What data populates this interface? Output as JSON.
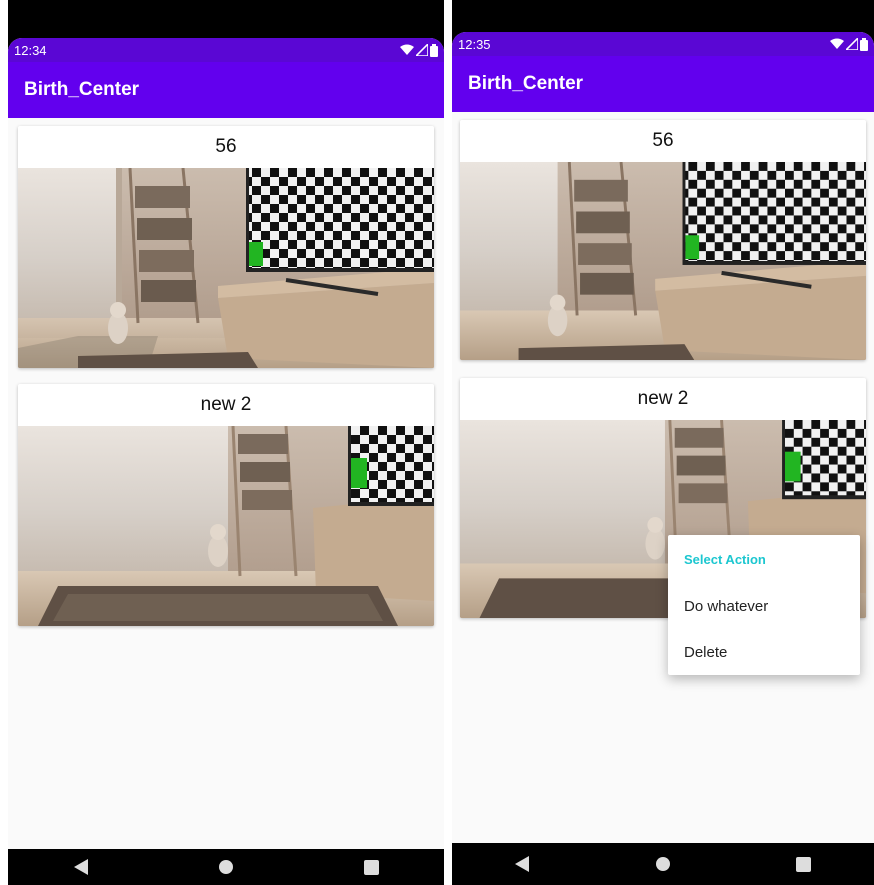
{
  "left_screen": {
    "status_bar": {
      "time": "12:34",
      "icons": [
        "wifi-icon",
        "signal-icon",
        "battery-icon"
      ]
    },
    "app_bar": {
      "title": "Birth_Center"
    },
    "cards": [
      {
        "title": "56"
      },
      {
        "title": "new 2"
      }
    ]
  },
  "right_screen": {
    "status_bar": {
      "time": "12:35",
      "icons": [
        "wifi-icon",
        "signal-icon",
        "battery-icon"
      ]
    },
    "app_bar": {
      "title": "Birth_Center"
    },
    "cards": [
      {
        "title": "56"
      },
      {
        "title": "new 2"
      }
    ],
    "context_menu": {
      "header": "Select Action",
      "items": [
        "Do whatever",
        "Delete"
      ]
    }
  },
  "navigation_bar": {
    "icons": [
      "back-icon",
      "home-icon",
      "recents-icon"
    ]
  },
  "colors": {
    "status_bar": "#5a07d4",
    "app_bar": "#6200ee",
    "menu_header": "#1cc7d0",
    "green_square": "#22b522"
  }
}
